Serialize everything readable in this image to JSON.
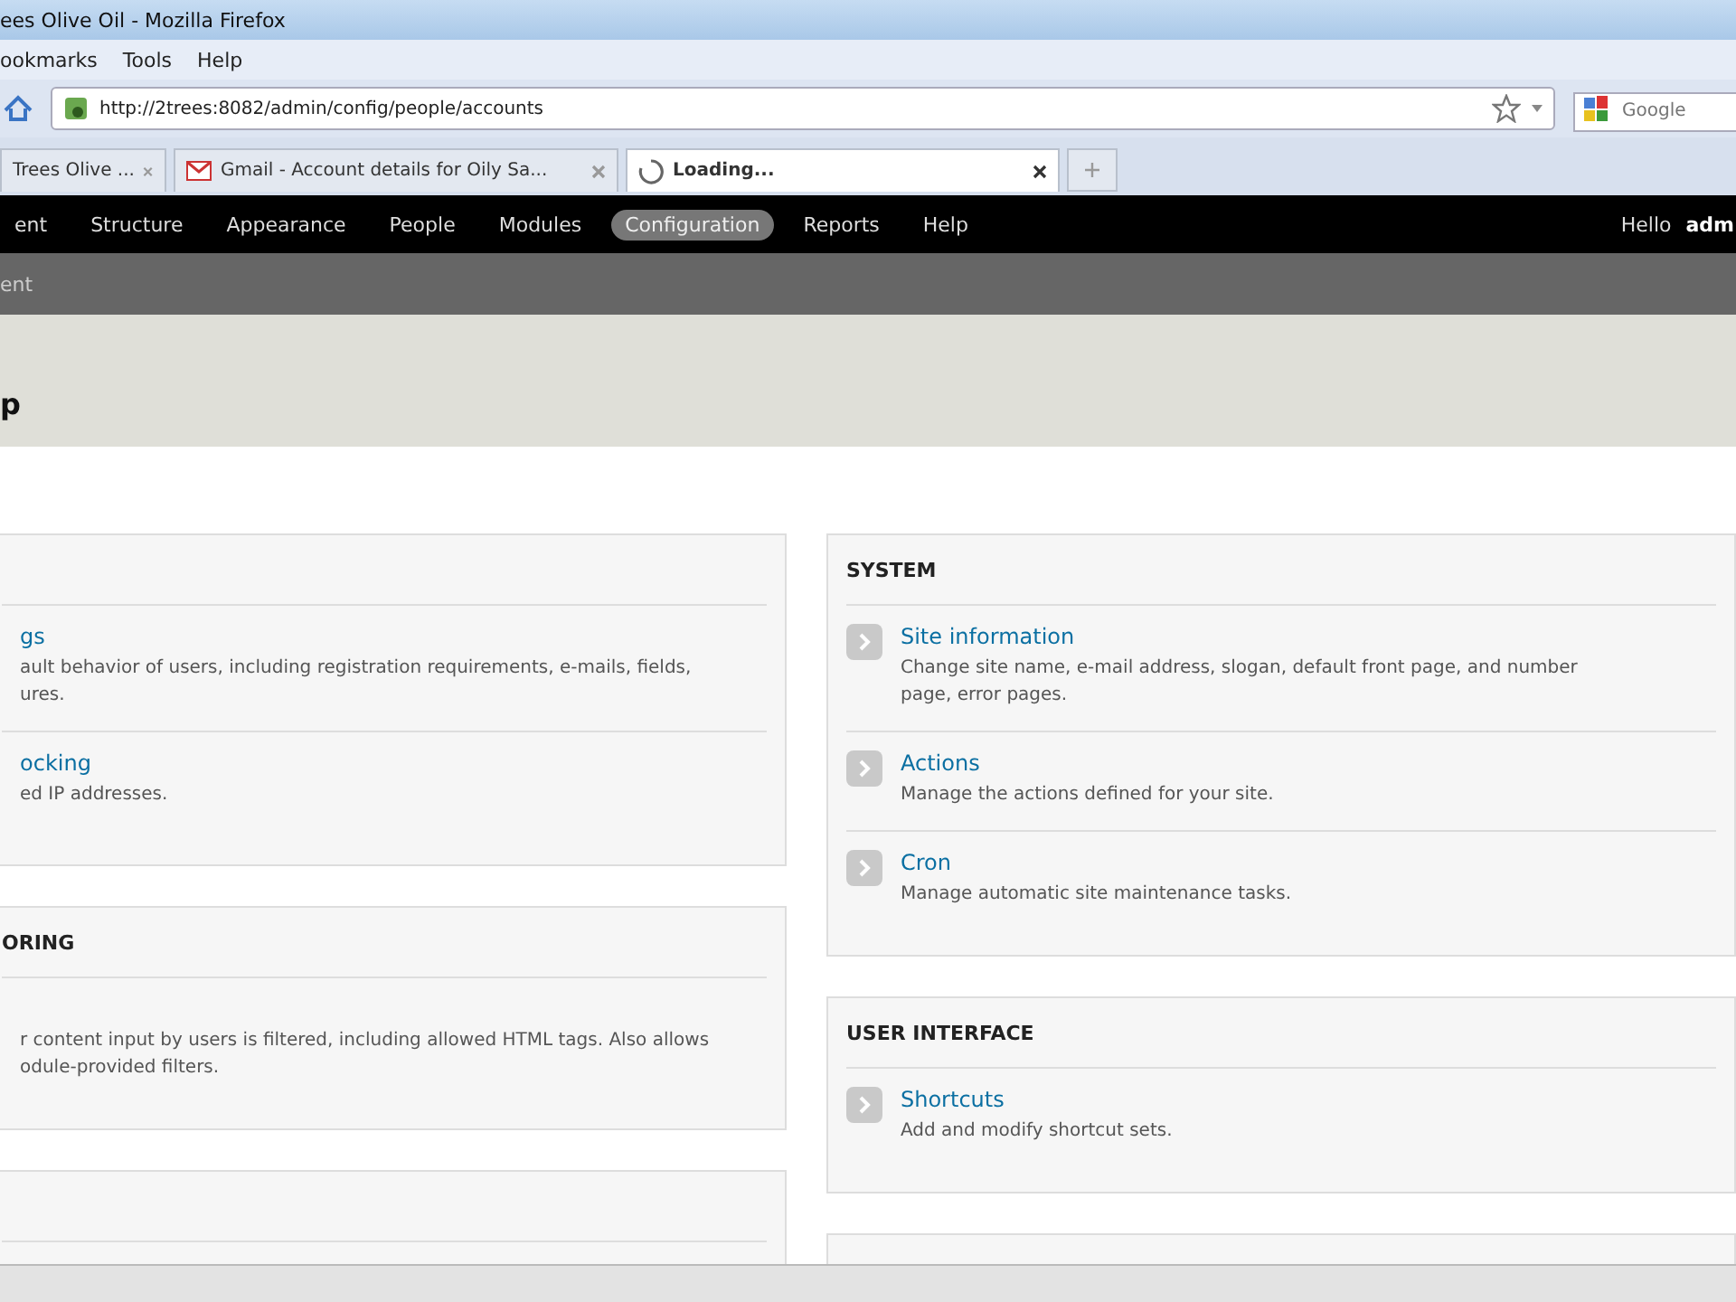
{
  "window": {
    "title": "ees Olive Oil - Mozilla Firefox"
  },
  "menu": [
    "ookmarks",
    "Tools",
    "Help"
  ],
  "address_bar": {
    "url": "http://2trees:8082/admin/config/people/accounts"
  },
  "search": {
    "placeholder": "Google"
  },
  "tabs": [
    {
      "label": "Trees Olive ...",
      "selected": false,
      "kind": "page"
    },
    {
      "label": "Gmail - Account details for Oily Sa...",
      "selected": false,
      "kind": "mail"
    },
    {
      "label": "Loading...",
      "selected": true,
      "kind": "loading"
    }
  ],
  "toolbar": {
    "items": [
      {
        "label": "ent",
        "selected": false
      },
      {
        "label": "Structure",
        "selected": false
      },
      {
        "label": "Appearance",
        "selected": false
      },
      {
        "label": "People",
        "selected": false
      },
      {
        "label": "Modules",
        "selected": false
      },
      {
        "label": "Configuration",
        "selected": true
      },
      {
        "label": "Reports",
        "selected": false
      },
      {
        "label": "Help",
        "selected": false
      }
    ],
    "greeting": "Hello",
    "user": "adm"
  },
  "shortcuts": [
    "ent"
  ],
  "page_title": "p",
  "columns": [
    [
      {
        "items": [
          {
            "title": "gs",
            "lines": [
              "ault behavior of users, including registration requirements, e-mails, fields,",
              "ures."
            ]
          },
          {
            "title": "ocking",
            "lines": [
              "ed IP addresses."
            ]
          }
        ]
      },
      {
        "heading": "ORING",
        "items": [
          {
            "lines": [
              "r content input by users is filtered, including allowed HTML tags. Also allows",
              "odule-provided filters."
            ]
          }
        ]
      },
      {}
    ],
    [
      {
        "heading": "SYSTEM",
        "items": [
          {
            "title": "Site information",
            "lines": [
              "Change site name, e-mail address, slogan, default front page, and number",
              "page, error pages."
            ]
          },
          {
            "title": "Actions",
            "lines": [
              "Manage the actions defined for your site."
            ]
          },
          {
            "title": "Cron",
            "lines": [
              "Manage automatic site maintenance tasks."
            ]
          }
        ]
      },
      {
        "heading": "USER INTERFACE",
        "items": [
          {
            "title": "Shortcuts",
            "lines": [
              "Add and modify shortcut sets."
            ]
          }
        ]
      },
      {}
    ]
  ]
}
